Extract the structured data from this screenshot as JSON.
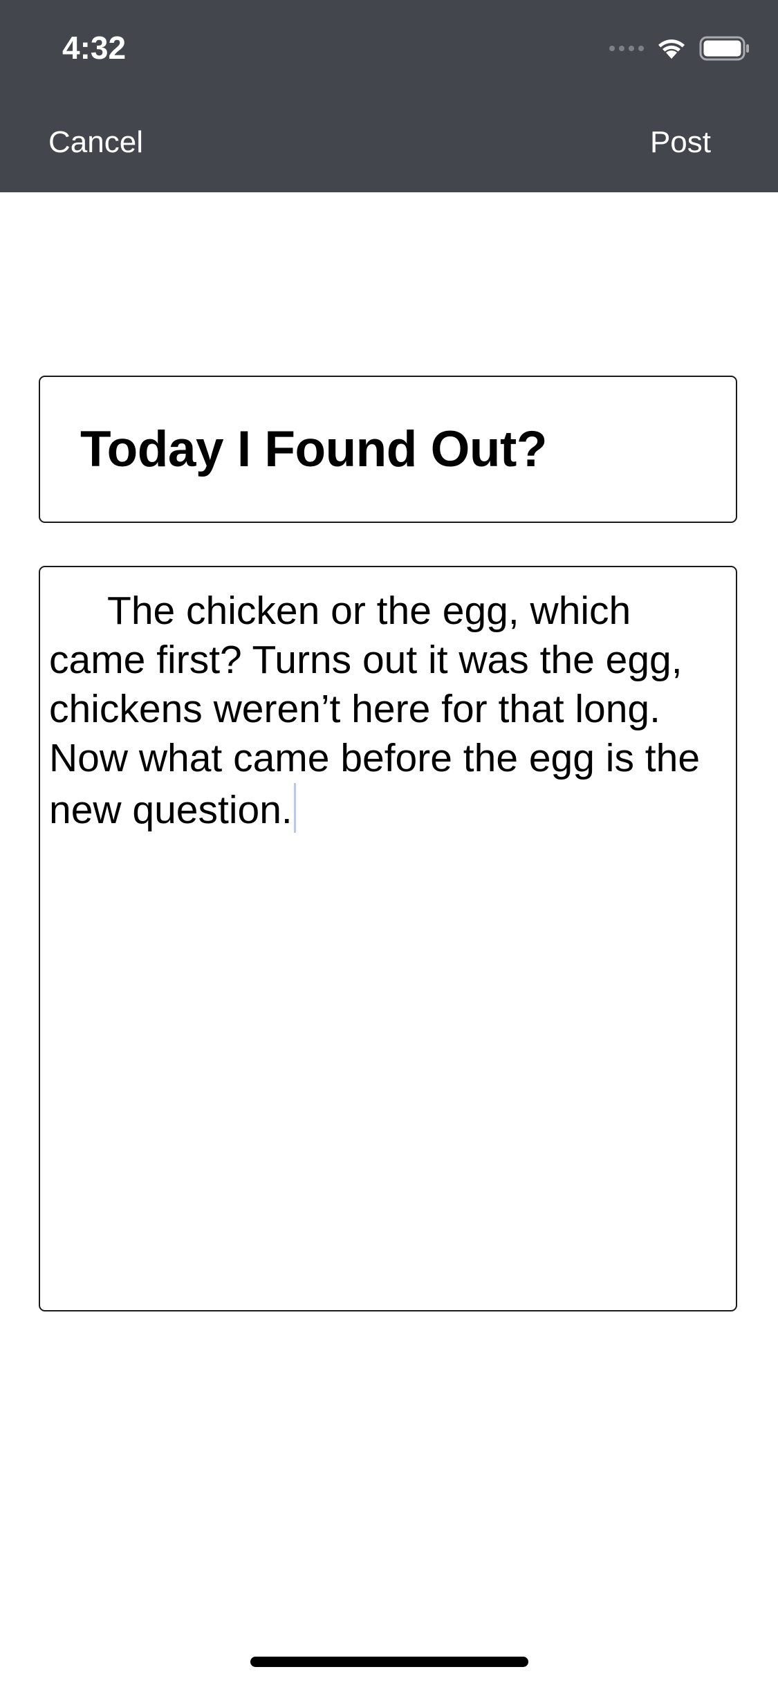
{
  "status_bar": {
    "time": "4:32",
    "icons": [
      "signal-dots-icon",
      "wifi-icon",
      "battery-icon"
    ]
  },
  "nav": {
    "cancel_label": "Cancel",
    "post_label": "Post"
  },
  "form": {
    "title_value": "Today I Found Out?",
    "body_value": "The chicken or the egg, which came first? Turns out it was the egg, chickens weren’t here for that long. Now what came before the egg is the new question."
  },
  "colors": {
    "topbar_background": "#43464c",
    "text_primary": "#000000",
    "caret": "#b9c6ef"
  }
}
